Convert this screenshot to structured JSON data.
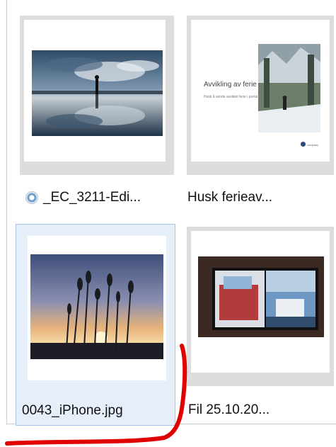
{
  "files": [
    {
      "name": "_EC_3211-Edi...",
      "icon": "media-player-icon"
    },
    {
      "name": "Husk ferieav..."
    },
    {
      "name": "0043_iPhone.jpg",
      "selected": true
    },
    {
      "name": "Fil 25.10.20..."
    }
  ],
  "colors": {
    "selection_bg": "#e5eef9",
    "selection_border": "#a9c6ea",
    "annotation": "#e00000"
  }
}
